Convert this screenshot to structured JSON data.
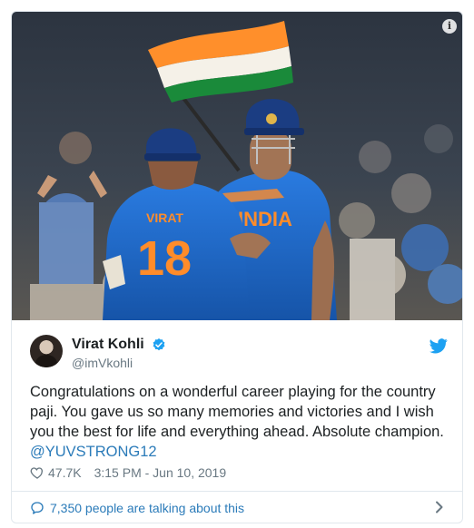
{
  "tweet": {
    "display_name": "Virat Kohli",
    "handle": "@imVkohli",
    "text": "Congratulations on a wonderful career playing for the country paji. You gave us so many memories and victories and I wish you the best for life and everything ahead. Absolute champion.",
    "mention": "@YUVSTRONG12",
    "likes": "47.7K",
    "timestamp": "3:15 PM - Jun 10, 2019",
    "talking_about": "7,350 people are talking about this"
  },
  "photo": {
    "left_jersey_name": "VIRAT",
    "left_jersey_number": "18",
    "right_jersey_text": "INDIA"
  },
  "icons": {
    "info": "info-icon",
    "verified": "verified-badge-icon",
    "brand": "twitter-bird-icon",
    "like": "heart-icon",
    "conversation": "speech-bubble-icon",
    "navigate": "chevron-right-icon"
  },
  "colors": {
    "link": "#2b7bb9",
    "secondary_text": "#697882",
    "border": "#e1e8ed",
    "jersey_blue": "#1f6fd0"
  }
}
